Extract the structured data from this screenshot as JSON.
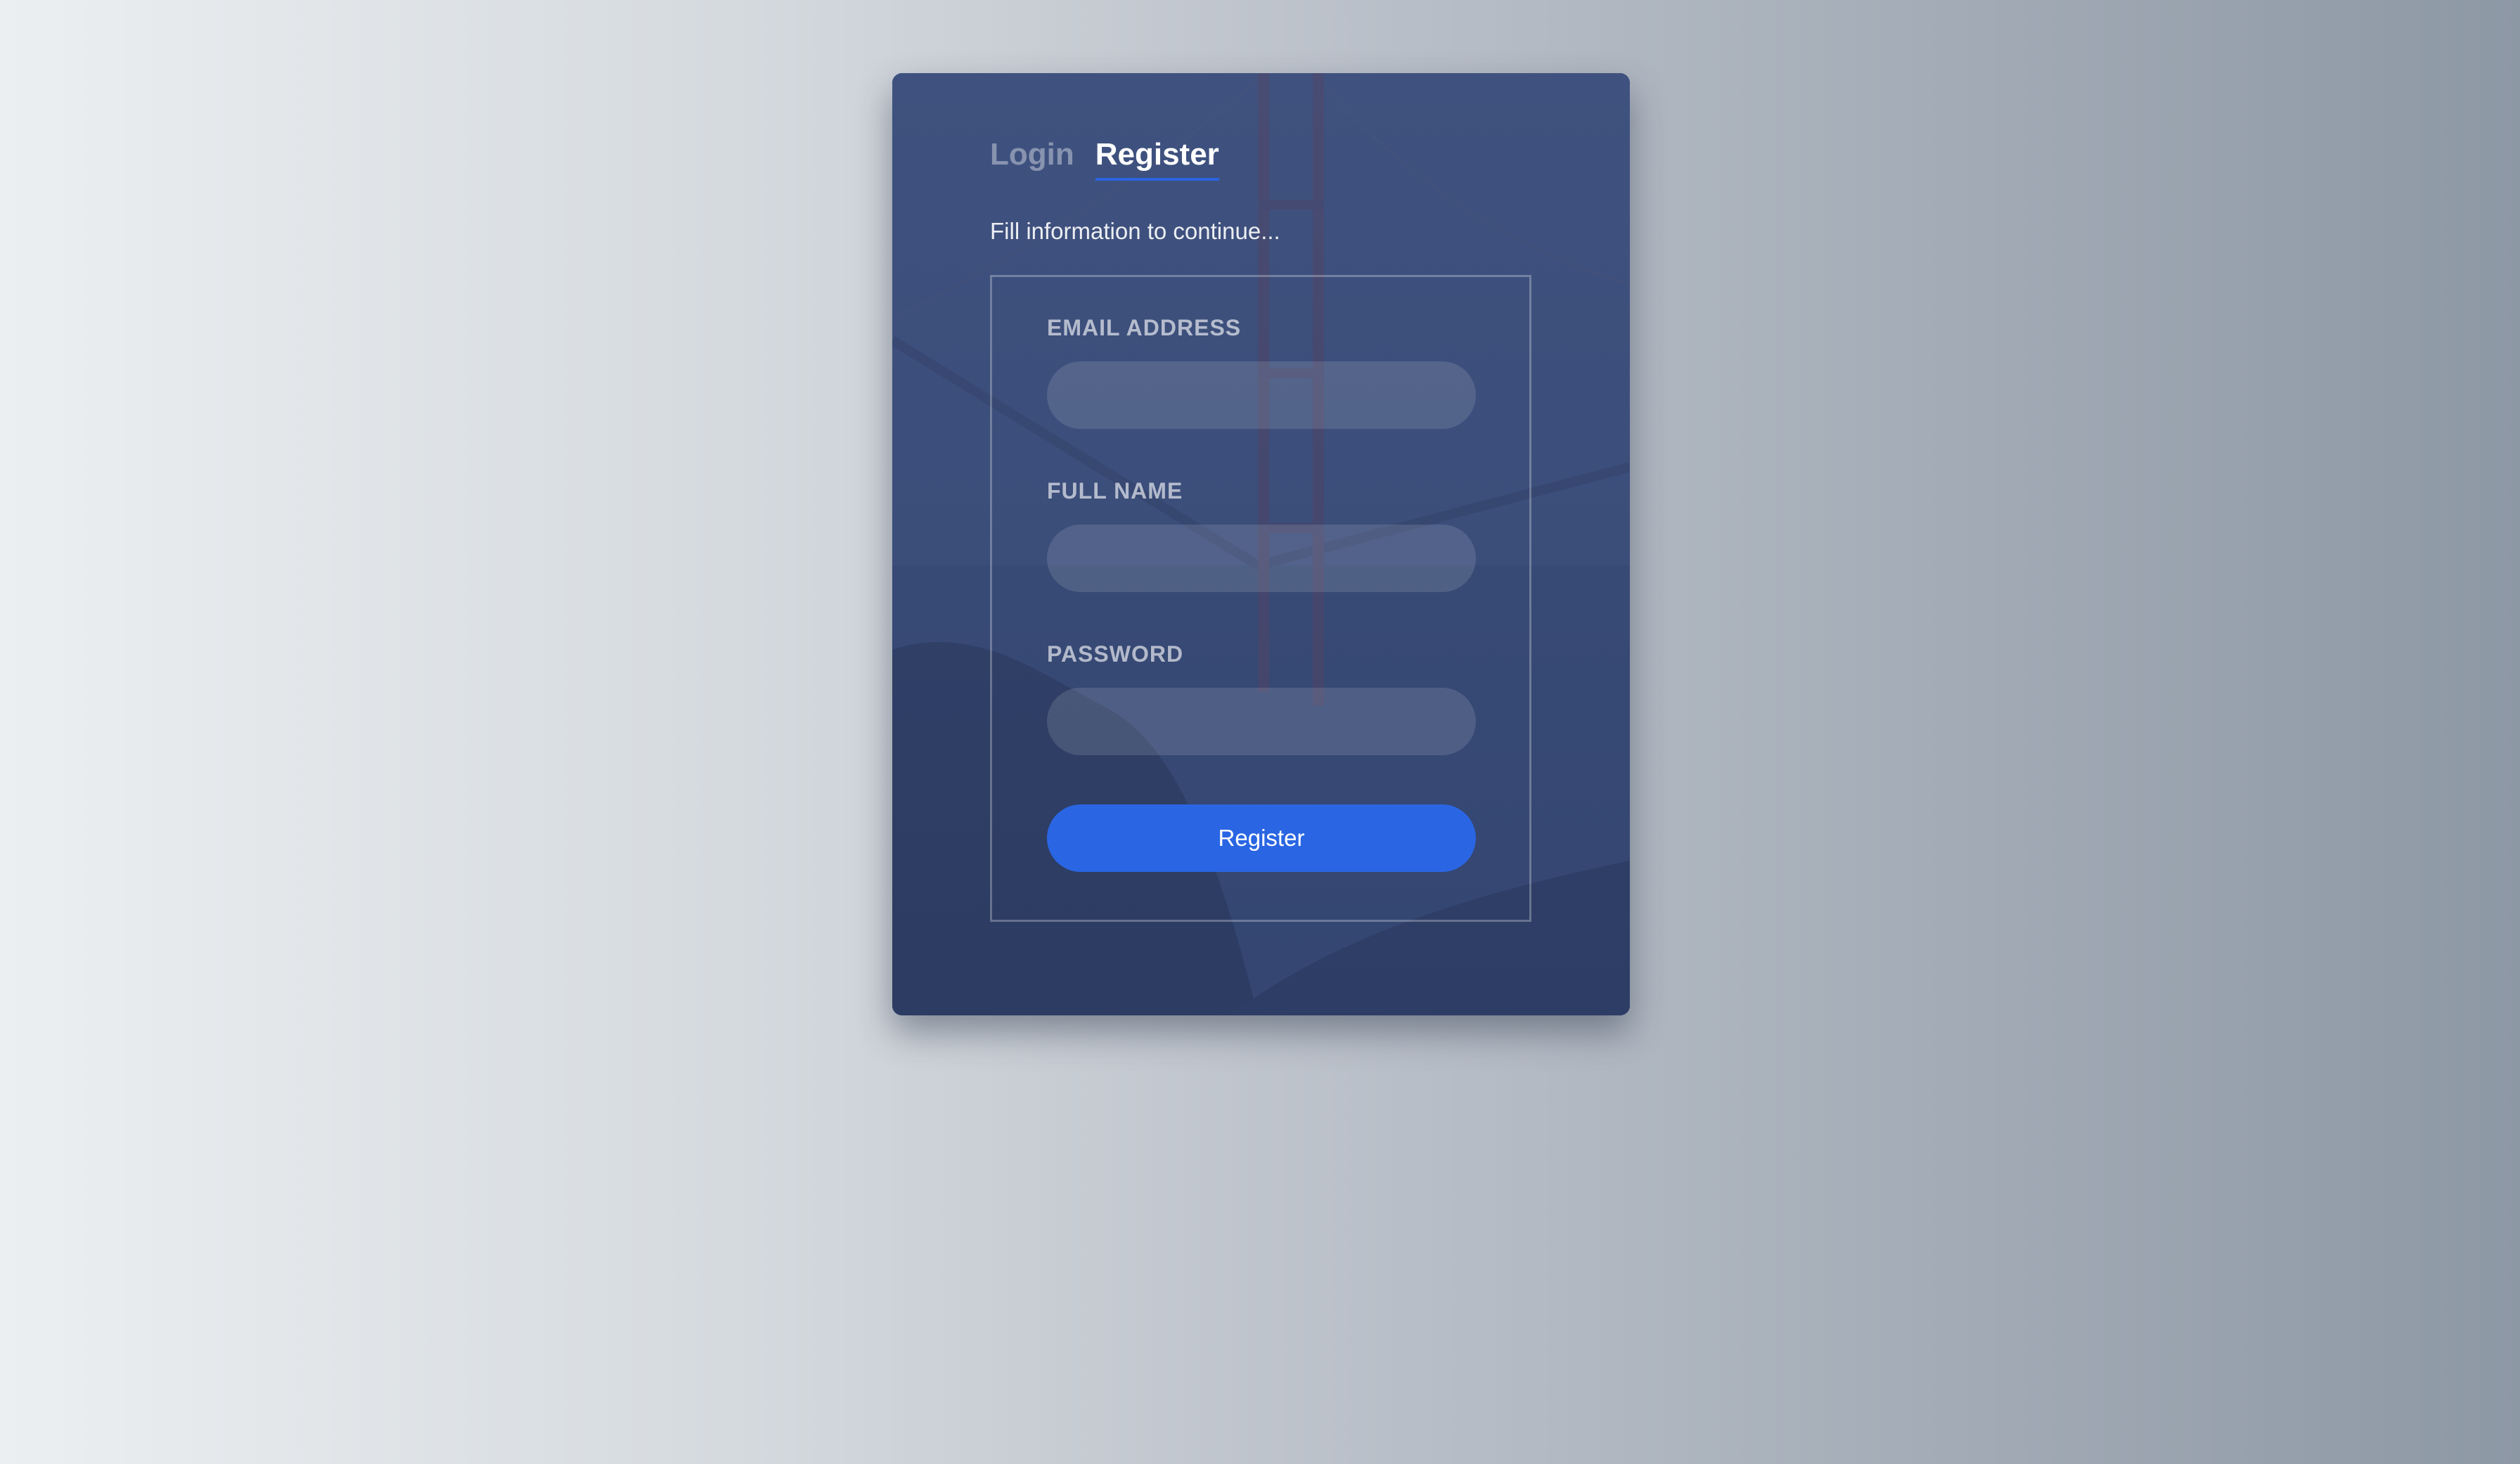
{
  "tabs": [
    {
      "label": "Login",
      "active": false
    },
    {
      "label": "Register",
      "active": true
    }
  ],
  "subtitle": "Fill information to continue...",
  "fields": [
    {
      "label": "EMAIL ADDRESS",
      "value": "",
      "placeholder": "",
      "type": "email"
    },
    {
      "label": "FULL NAME",
      "value": "",
      "placeholder": "",
      "type": "text"
    },
    {
      "label": "PASSWORD",
      "value": "",
      "placeholder": "",
      "type": "password"
    }
  ],
  "submit_label": "Register",
  "colors": {
    "accent": "#2a66e3",
    "card": "#34466e",
    "text": "#ffffff"
  },
  "background_image": "golden-gate-bridge-photo"
}
